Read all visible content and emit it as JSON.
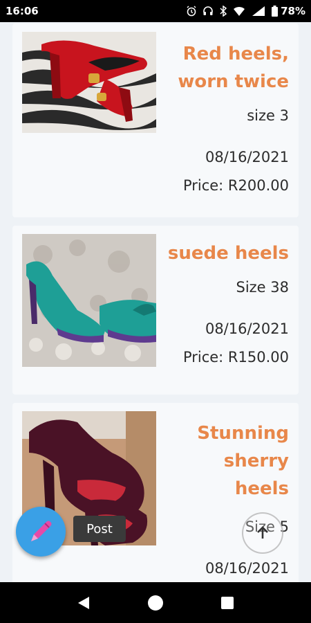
{
  "status_bar": {
    "time": "16:06",
    "battery": "78%"
  },
  "listings": [
    {
      "title": "Red heels, worn twice",
      "title_lines": [
        "Red heels,",
        "worn twice"
      ],
      "size": "size 3",
      "date": "08/16/2021",
      "price": "Price: R200.00",
      "image_icon": "red-suede-heels-photo"
    },
    {
      "title": "suede heels",
      "title_lines": [
        "suede heels"
      ],
      "size": "Size 38",
      "date": "08/16/2021",
      "price": "Price: R150.00",
      "image_icon": "teal-suede-heels-photo"
    },
    {
      "title": "Stunning sherry heels",
      "title_lines": [
        "Stunning",
        "sherry",
        "heels"
      ],
      "size": "Size 5",
      "date": "08/16/2021",
      "image_icon": "sherry-heels-photo"
    }
  ],
  "post_button": {
    "tooltip": "Post",
    "icon": "pencil-icon"
  },
  "scroll_top": {
    "icon": "arrow-up-icon"
  },
  "colors": {
    "title": "#e8874a",
    "fab": "#3aa0e6",
    "background": "#eef2f6"
  }
}
